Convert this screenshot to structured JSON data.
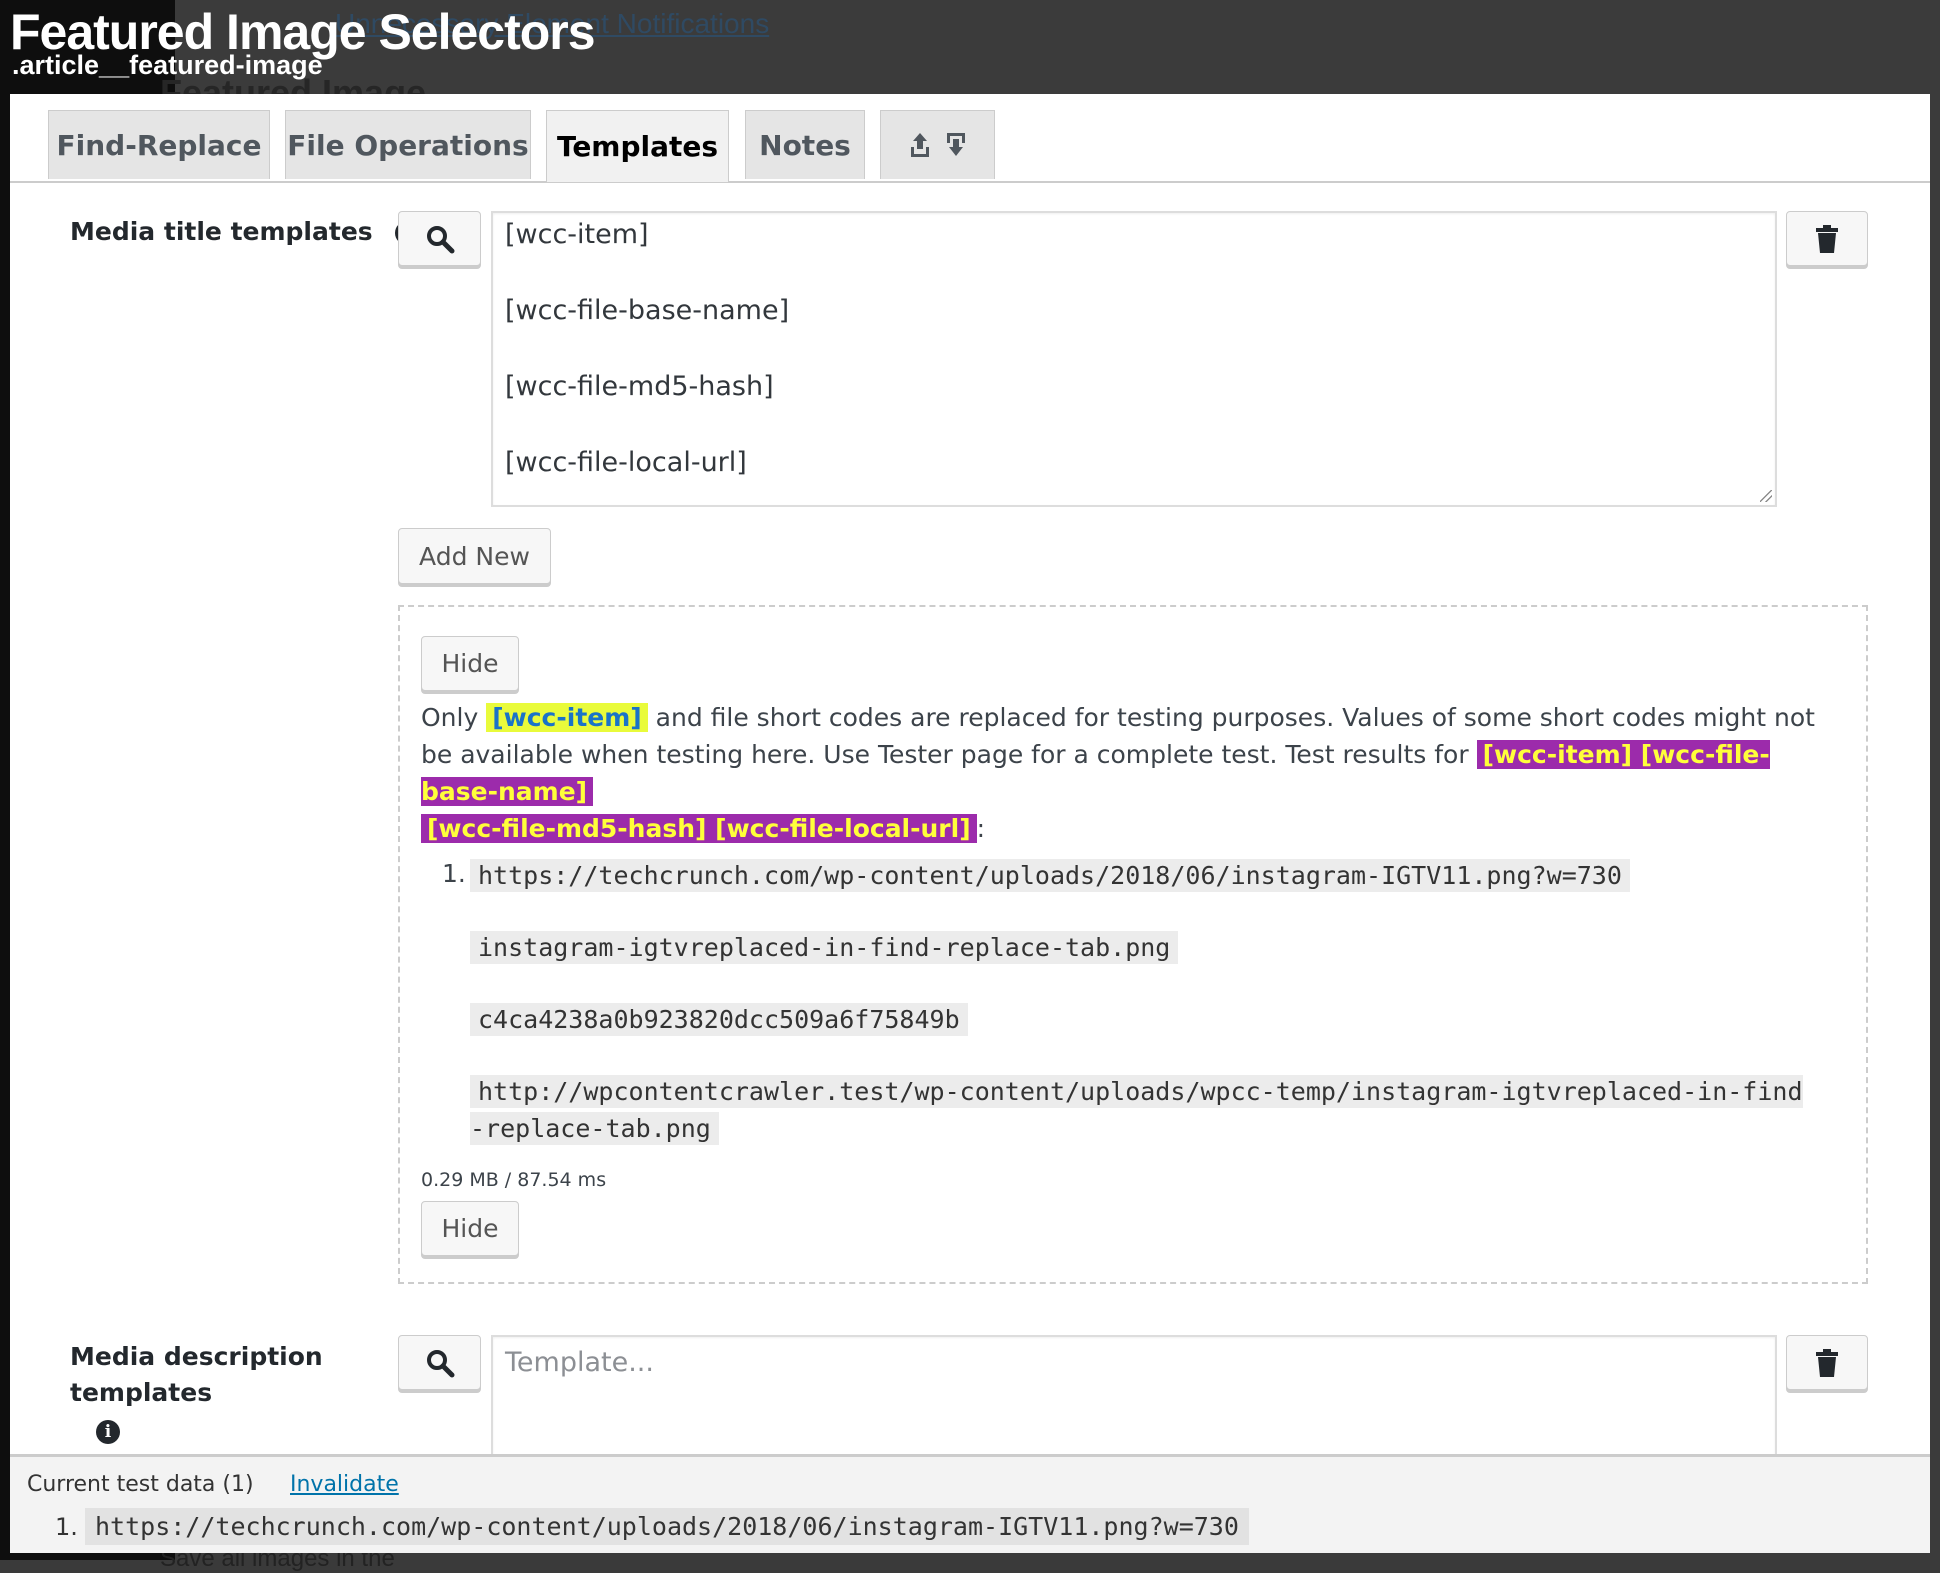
{
  "background": {
    "link": "Unnecessary Element Notifications",
    "heading": "Featured Image",
    "bottom_text": "Save all images in the"
  },
  "header": {
    "title": "Featured Image Selectors",
    "subtitle": ".article__featured-image"
  },
  "tabs": [
    {
      "label": "Find-Replace",
      "active": false
    },
    {
      "label": "File Operations",
      "active": false
    },
    {
      "label": "Templates",
      "active": true
    },
    {
      "label": "Notes",
      "active": false
    },
    {
      "icons": [
        "export-icon",
        "import-icon"
      ],
      "active": false
    }
  ],
  "media_title": {
    "label": "Media title templates",
    "lines": [
      "[wcc-item]",
      "[wcc-file-base-name]",
      "[wcc-file-md5-hash]",
      "[wcc-file-local-url]"
    ],
    "add_new_label": "Add New"
  },
  "test_panel": {
    "hide_label": "Hide",
    "text_only": "Only",
    "code_item": "[wcc-item]",
    "text_mid": "and file short codes are replaced for testing purposes. Values of some short codes might not be available when testing here. Use Tester page for a complete test. Test results for",
    "code_all_1": "[wcc-item] [wcc-file-base-name]",
    "code_all_2": "[wcc-file-md5-hash] [wcc-file-local-url]",
    "text_end": ":",
    "result_number": "1.",
    "results": [
      "https://techcrunch.com/wp-content/uploads/2018/06/instagram-IGTV11.png?w=730",
      "instagram-igtvreplaced-in-find-replace-tab.png",
      "c4ca4238a0b923820dcc509a6f75849b",
      "http://wpcontentcrawler.test/wp-content/uploads/wpcc-temp/instagram-igtvreplaced-in-find-replace-tab.png"
    ],
    "meta": "0.29 MB / 87.54 ms"
  },
  "media_description": {
    "label_1": "Media description",
    "label_2": "templates",
    "placeholder": "Template..."
  },
  "current_test_data": {
    "title": "Current test data  (1)",
    "invalidate_label": "Invalidate",
    "items": [
      {
        "number": "1.",
        "url": "https://techcrunch.com/wp-content/uploads/2018/06/instagram-IGTV11.png?w=730"
      }
    ]
  },
  "colors": {
    "highlight_yellow": "#e9fb3b",
    "highlight_purple": "#9c2bab",
    "link": "#0073aa"
  }
}
